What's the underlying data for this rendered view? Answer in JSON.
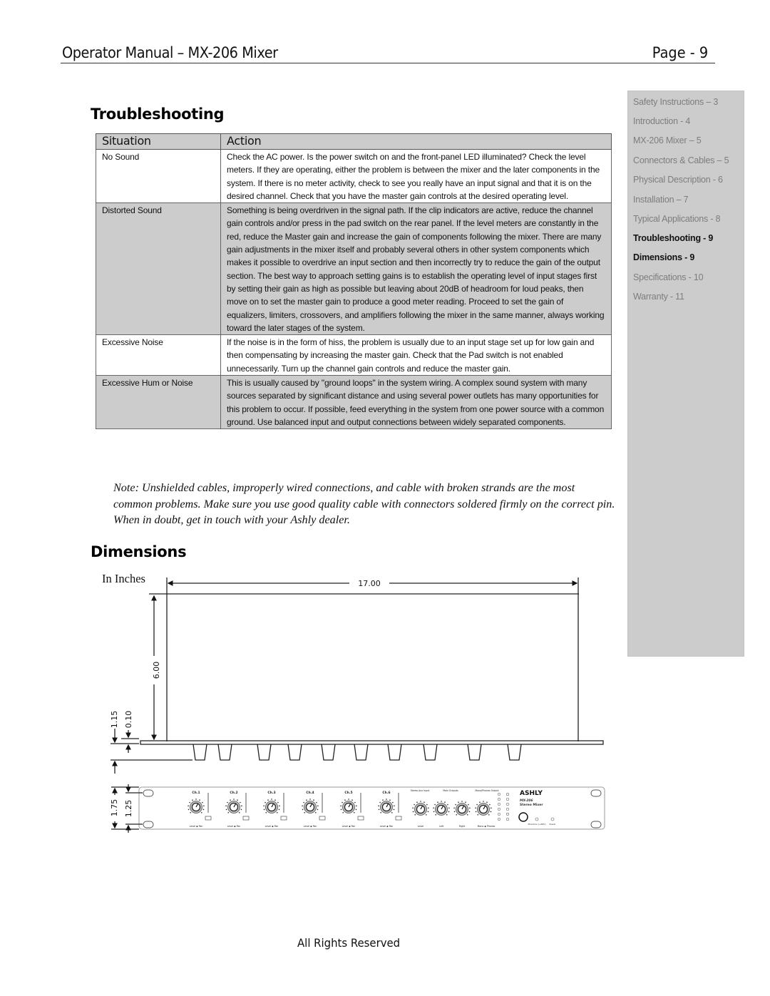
{
  "header": {
    "title": "Operator Manual – MX-206 Mixer",
    "page": "Page - 9"
  },
  "sidebar": {
    "items": [
      {
        "label": "Safety Instructions – 3",
        "current": false
      },
      {
        "label": "Introduction - 4",
        "current": false
      },
      {
        "label": "MX-206 Mixer – 5",
        "current": false
      },
      {
        "label": "Connectors & Cables – 5",
        "current": false
      },
      {
        "label": "Physical Description - 6",
        "current": false
      },
      {
        "label": "Installation – 7",
        "current": false
      },
      {
        "label": "Typical Applications - 8",
        "current": false
      },
      {
        "label": "Troubleshooting - 9",
        "current": true
      },
      {
        "label": "Dimensions - 9",
        "current": true
      },
      {
        "label": "Specifications - 10",
        "current": false
      },
      {
        "label": "Warranty - 11",
        "current": false
      }
    ]
  },
  "troubleshooting": {
    "title": "Troubleshooting",
    "columns": [
      "Situation",
      "Action"
    ],
    "rows": [
      {
        "situation": "No Sound",
        "action": "Check the AC power. Is the power switch on and the front-panel LED illuminated? Check the level meters. If they are operating, either the problem is between the mixer and the later components in the system. If there is no meter activity, check to see you really have an input signal and that it is on the desired channel. Check that you have the master gain controls at the desired operating level.",
        "shaded": false
      },
      {
        "situation": "Distorted Sound",
        "action": "Something is being overdriven in the signal path. If the clip indicators are active, reduce the channel gain controls and/or press in the pad switch on the rear panel. If the level meters are constantly in the red, reduce the Master gain and increase the gain of components following the mixer. There are many gain adjustments in the mixer itself and probably several others in other system components which makes it possible to overdrive an input section and then incorrectly try to reduce the gain of the output section. The best way to approach setting gains is to establish the operating level of input stages first by setting their gain as high as possible but leaving about 20dB of headroom for loud peaks, then move on to set the master gain to produce a good meter reading. Proceed to set the gain of equalizers, limiters, crossovers, and amplifiers following the mixer in the same manner, always working toward the later stages of the system.",
        "shaded": true
      },
      {
        "situation": "Excessive Noise",
        "action": "If the noise is in the form of hiss, the problem is usually due to an input stage set up for low gain and then compensating by increasing the master gain. Check that the Pad switch is not enabled unnecessarily. Turn up the channel gain controls and reduce the master gain.",
        "shaded": false
      },
      {
        "situation": "Excessive Hum or Noise",
        "action": "This is usually caused by \"ground loops\" in the system wiring. A complex sound system with many sources separated by significant distance and using several power outlets has many opportunities for this problem to occur. If possible, feed everything in the system from one power source with a common ground. Use balanced input and output connections between widely separated components.",
        "shaded": true
      }
    ],
    "note": "Note: Unshielded cables, improperly wired connections, and cable with broken strands are the most common problems. Make sure you use good quality cable with connectors soldered firmly on the correct pin. When in doubt, get in touch with your Ashly dealer."
  },
  "dimensions": {
    "title": "Dimensions",
    "units": "In Inches",
    "width": "17.00",
    "depth": "6.00",
    "knob_depth": "1.15",
    "panel_thickness": "0.10",
    "front_height": "1.75",
    "hole_spacing": "1.25",
    "front_panel": {
      "brand": "ASHLY",
      "model": "MX-206",
      "subtitle": "Stereo Mixer",
      "channels": [
        "Ch.1",
        "Ch.2",
        "Ch.3",
        "Ch.4",
        "Ch.5",
        "Ch.6"
      ],
      "channel_bottom_label": "Level ◆ Pan",
      "aux_label": "Stereo Aux Input",
      "aux_bottom": "Level",
      "main_outputs_label": "Main Outputs",
      "left_label": "Left",
      "right_label": "Right",
      "mono_label": "Mono/Phones Output",
      "mono_bottom": "Mono ◆ Phones",
      "phantom_label": "Phantom (+48V)",
      "power_label": "Power"
    }
  },
  "footer": {
    "text": "All Rights Reserved"
  }
}
